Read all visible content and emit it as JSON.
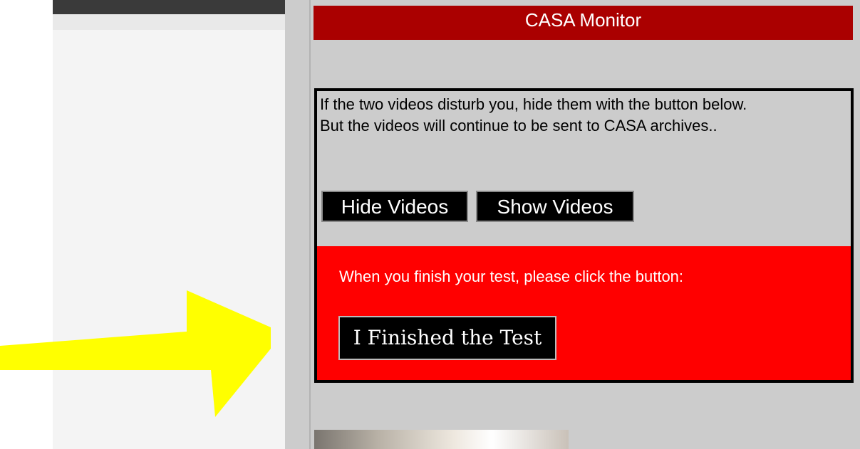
{
  "window": {
    "title": "CASA Monitor"
  },
  "info": {
    "line1": "If the two videos disturb you, hide them with the button below.",
    "line2": "But the videos will continue to be sent to CASA archives.."
  },
  "buttons": {
    "hide_videos": "Hide Videos",
    "show_videos": "Show Videos",
    "finished_test": "I Finished the Test"
  },
  "finish": {
    "prompt": "When you finish your test, please click the button:"
  },
  "colors": {
    "header_bg": "#aa0000",
    "panel_bg": "#ff0000",
    "arrow": "#ffff00"
  },
  "icons": {
    "annotation": "yellow-arrow"
  }
}
